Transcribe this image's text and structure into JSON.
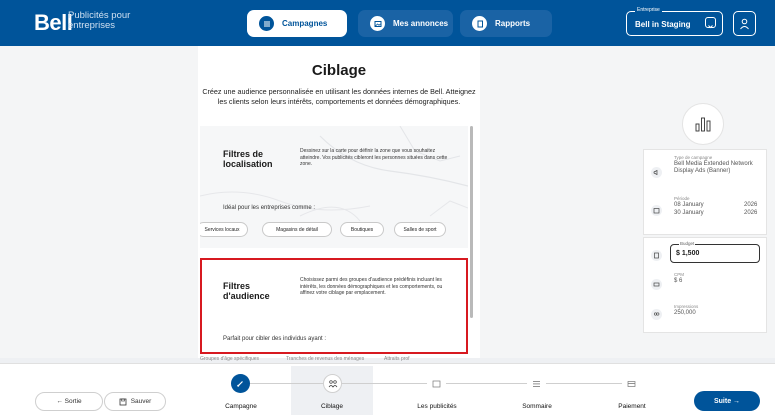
{
  "header": {
    "logo": "Bell",
    "logo_sub": "Publicités pour entreprises",
    "nav": [
      {
        "label": "Campagnes"
      },
      {
        "label": "Mes annonces"
      },
      {
        "label": "Rapports"
      }
    ],
    "entreprise_label": "Entreprise",
    "entreprise_value": "Bell in Staging"
  },
  "main": {
    "title": "Ciblage",
    "subtitle": "Créez une audience personnalisée en utilisant les données internes de Bell. Atteignez les clients selon leurs intérêts, comportements et données démographiques.",
    "location_card": {
      "title": "Filtres de localisation",
      "desc": "Dessinez sur la carte pour définir la zone que vous souhaitez atteindre. Vos publicités cibleront les personnes situées dans cette zone.",
      "ideal": "Idéal pour les entreprises comme :",
      "pills": [
        "Services locaux",
        "Magasins de détail",
        "Boutiques",
        "Salles de sport"
      ]
    },
    "audience_card": {
      "title": "Filtres d'audience",
      "desc": "Choisissez parmi des groupes d'audience prédéfinis incluant les intérêts, les données démographiques et les comportements, ou affinez votre ciblage par emplacement.",
      "foot": "Parfait pour cibler des individus ayant :"
    },
    "cut_off": [
      "Groupes d'âge spécifiques",
      "Tranches de revenus des ménages",
      "Attraits prof"
    ]
  },
  "summary": {
    "type_label": "Type de campagne",
    "type_value": "Bell Media Extended Network Display Ads (Banner)",
    "period_label": "Période",
    "period_start": "08 January",
    "period_start_year": "2026",
    "period_end": "30 January",
    "period_end_year": "2026",
    "budget_label": "Budget",
    "budget_value": "$ 1,500",
    "cpm_label": "CPM",
    "cpm_value": "$ 6",
    "impressions_label": "Impressions",
    "impressions_value": "250,000"
  },
  "footer": {
    "sortie": "← Sortie",
    "sauver": "Sauver",
    "steps": [
      "Campagne",
      "Ciblage",
      "Les publicités",
      "Sommaire",
      "Paiement"
    ],
    "suite": "Suite →"
  },
  "colors": {
    "brand": "#00549a",
    "highlight": "#d71920"
  }
}
